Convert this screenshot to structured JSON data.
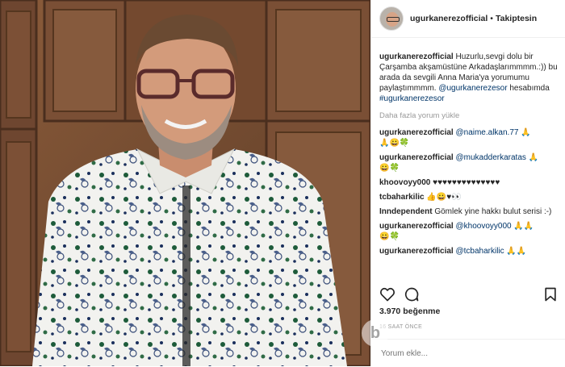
{
  "header": {
    "username": "ugurkanerezofficial",
    "separator": "•",
    "follow_label": "Takiptesin"
  },
  "caption": {
    "user": "ugurkanerezofficial",
    "text": "Huzurlu,sevgi dolu bir Çarşamba akşamüstüne Arkadaşlarımmmm.:)) bu arada da sevgili Anna Maria'ya yorumumu paylaştımmmm.",
    "mention": "@ugurkanerezesor",
    "text2": " hesabımda ",
    "hashtag": "#ugurkanerezesor"
  },
  "load_more": "Daha fazla yorum yükle",
  "comments": [
    {
      "user": "ugurkanerezofficial",
      "mention": "@naime.alkan.77",
      "text": " 🙏",
      "line2": "🙏😀🍀"
    },
    {
      "user": "ugurkanerezofficial",
      "mention": "@mukadderkaratas",
      "text": " 🙏",
      "line2": "😀🍀"
    },
    {
      "user": "khoovoyy000",
      "mention": "",
      "text": " ♥♥♥♥♥♥♥♥♥♥♥♥♥♥",
      "line2": ""
    },
    {
      "user": "tcbaharkilic",
      "mention": "",
      "text": " 👍😀♥👀",
      "line2": ""
    },
    {
      "user": "Inndependent",
      "mention": "",
      "text": " Gömlek yine hakkı bulut serisi :-)",
      "line2": ""
    },
    {
      "user": "ugurkanerezofficial",
      "mention": "@khoovoyy000",
      "text": " 🙏🙏",
      "line2": "😀🍀"
    },
    {
      "user": "ugurkanerezofficial",
      "mention": "@tcbaharkilic",
      "text": " 🙏🙏",
      "line2": ""
    }
  ],
  "likes": "3.970 beğenme",
  "time": "16 SAAT ÖNCE",
  "add_comment_placeholder": "Yorum ekle...",
  "icons": [
    "heart-icon",
    "comment-icon",
    "bookmark-icon"
  ],
  "watermark": "b",
  "colors": {
    "link": "#003569",
    "muted": "#999999",
    "border": "#efefef"
  }
}
